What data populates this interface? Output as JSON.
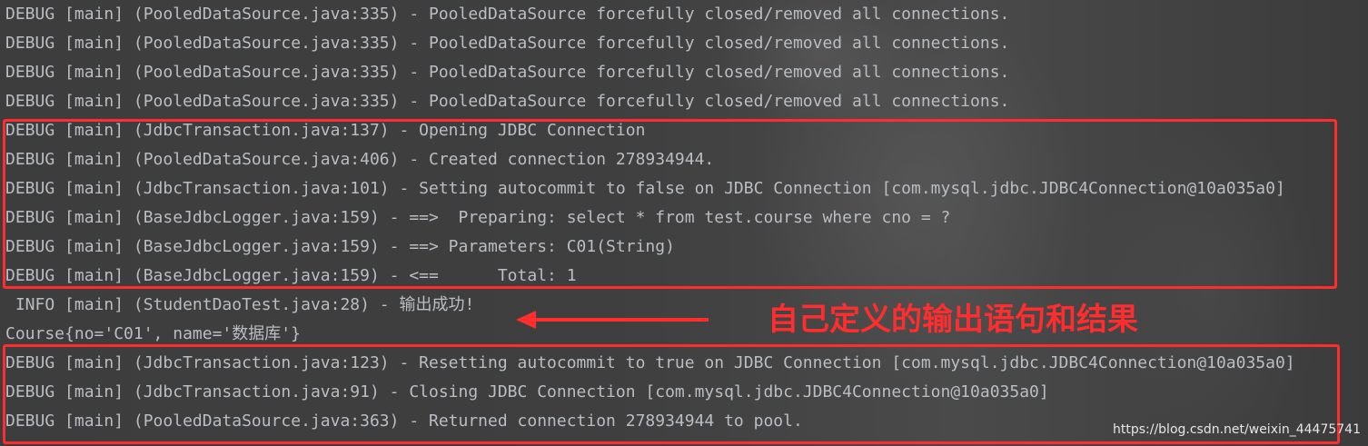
{
  "console": {
    "lines": [
      "DEBUG [main] (PooledDataSource.java:335) - PooledDataSource forcefully closed/removed all connections.",
      "DEBUG [main] (PooledDataSource.java:335) - PooledDataSource forcefully closed/removed all connections.",
      "DEBUG [main] (PooledDataSource.java:335) - PooledDataSource forcefully closed/removed all connections.",
      "DEBUG [main] (PooledDataSource.java:335) - PooledDataSource forcefully closed/removed all connections.",
      "DEBUG [main] (JdbcTransaction.java:137) - Opening JDBC Connection",
      "DEBUG [main] (PooledDataSource.java:406) - Created connection 278934944.",
      "DEBUG [main] (JdbcTransaction.java:101) - Setting autocommit to false on JDBC Connection [com.mysql.jdbc.JDBC4Connection@10a035a0]",
      "DEBUG [main] (BaseJdbcLogger.java:159) - ==>  Preparing: select * from test.course where cno = ?",
      "DEBUG [main] (BaseJdbcLogger.java:159) - ==> Parameters: C01(String)",
      "DEBUG [main] (BaseJdbcLogger.java:159) - <==      Total: 1",
      " INFO [main] (StudentDaoTest.java:28) - 输出成功!",
      "Course{no='C01', name='数据库'}",
      "DEBUG [main] (JdbcTransaction.java:123) - Resetting autocommit to true on JDBC Connection [com.mysql.jdbc.JDBC4Connection@10a035a0]",
      "DEBUG [main] (JdbcTransaction.java:91) - Closing JDBC Connection [com.mysql.jdbc.JDBC4Connection@10a035a0]",
      "DEBUG [main] (PooledDataSource.java:363) - Returned connection 278934944 to pool."
    ]
  },
  "annotation": {
    "text": "自己定义的输出语句和结果",
    "color": "#ff2d2d"
  },
  "watermark": {
    "text": "https://blog.csdn.net/weixin_44475741"
  },
  "colors": {
    "log_text": "#b9bec4",
    "highlight": "#ff2d2d"
  }
}
